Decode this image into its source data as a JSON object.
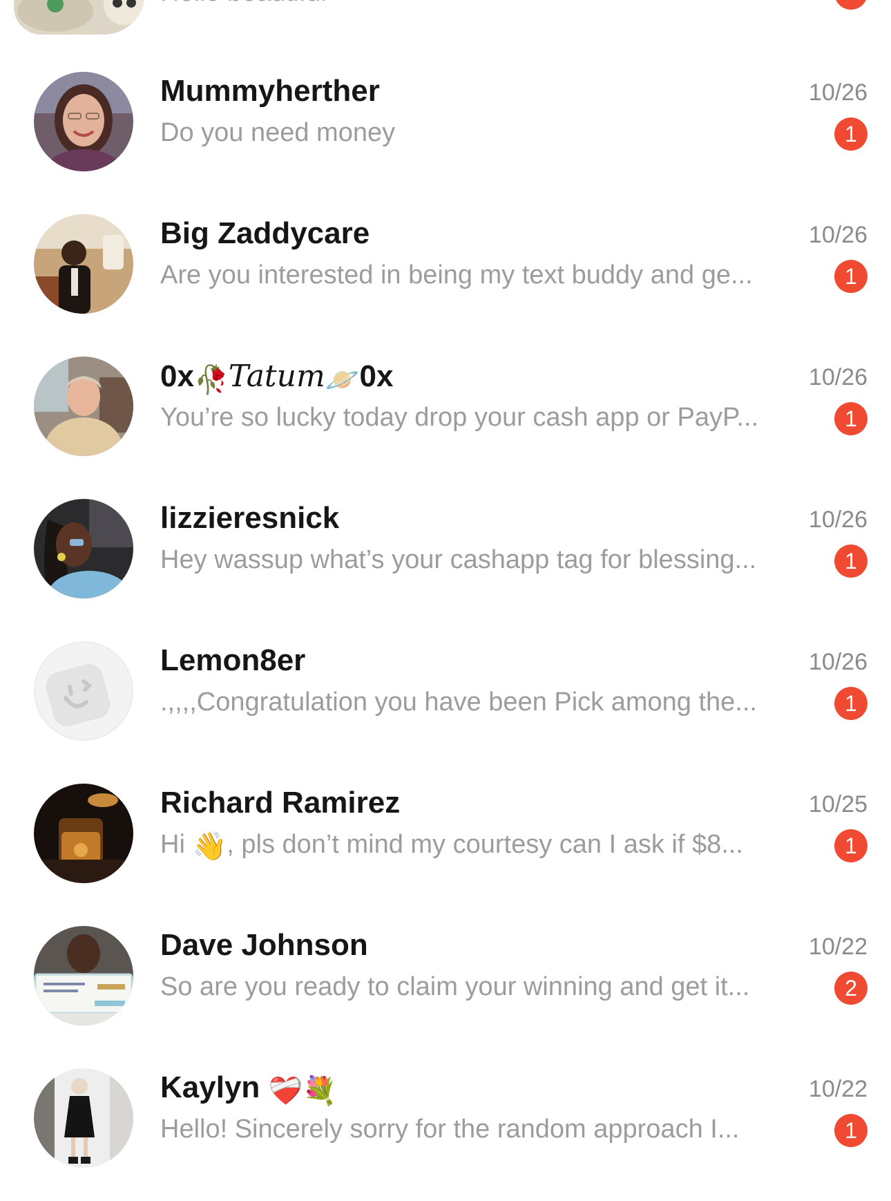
{
  "colors": {
    "badge": "#f04a32",
    "name": "#161616",
    "preview": "#9c9c9c",
    "date": "#8a8a8a"
  },
  "partial_top": {
    "preview": "Hello beautiful"
  },
  "conversations": [
    {
      "name": "Mummyherther",
      "date": "10/26",
      "preview": "Do you need money",
      "unread": "1"
    },
    {
      "name": "Big Zaddycare",
      "date": "10/26",
      "preview": "Are you interested in being my text buddy and ge...",
      "unread": "1"
    },
    {
      "name_pre": "0x",
      "name_script": "Tatum",
      "name_post": "0x",
      "date": "10/26",
      "preview": "You’re so lucky today drop your cash app or PayP...",
      "unread": "1"
    },
    {
      "name": "lizzieresnick",
      "date": "10/26",
      "preview": "Hey wassup what’s your cashapp tag for blessing...",
      "unread": "1"
    },
    {
      "name": "Lemon8er",
      "date": "10/26",
      "preview": ".,,,,Congratulation you have been Pick  among the...",
      "unread": "1"
    },
    {
      "name": "Richard Ramirez",
      "date": "10/25",
      "preview_pre": "Hi ",
      "preview_emoji": "👋",
      "preview_post": ", pls don’t mind my courtesy can I ask if $8...",
      "unread": "1"
    },
    {
      "name": "Dave Johnson",
      "date": "10/22",
      "preview": "So are you ready to claim your winning and get it...",
      "unread": "2"
    },
    {
      "name": "Kaylyn",
      "name_emoji": "❤️‍🩹💐",
      "date": "10/22",
      "preview": "Hello! Sincerely sorry for the random approach I...",
      "unread": "1"
    }
  ]
}
